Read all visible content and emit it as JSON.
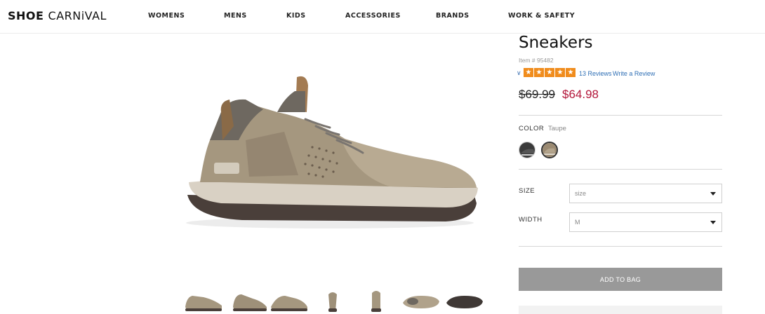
{
  "header": {
    "logo_bold": "SHOE ",
    "logo_rest": "CARNiVAL",
    "nav": [
      "WOMENS",
      "MENS",
      "KIDS",
      "ACCESSORIES",
      "BRANDS",
      "WORK & SAFETY"
    ]
  },
  "product": {
    "title": "Sneakers",
    "item_number": "Item # 95482",
    "rating_stars": 5,
    "reviews_text": "13 Reviews",
    "write_review_text": "Write a Review",
    "price_original": "$69.99",
    "price_sale": "$64.98",
    "color_label": "COLOR",
    "color_value": "Taupe",
    "swatches": [
      {
        "name": "Charcoal",
        "color": "#3a3a3a"
      },
      {
        "name": "Taupe",
        "color": "#9b8a72"
      }
    ],
    "size_label": "SIZE",
    "size_placeholder": "size",
    "width_label": "WIDTH",
    "width_value": "M",
    "add_to_bag": "ADD TO BAG"
  },
  "colors": {
    "sale_price": "#b3163a",
    "star": "#f08c1c",
    "link": "#2f6fb5",
    "add_button": "#999999"
  }
}
